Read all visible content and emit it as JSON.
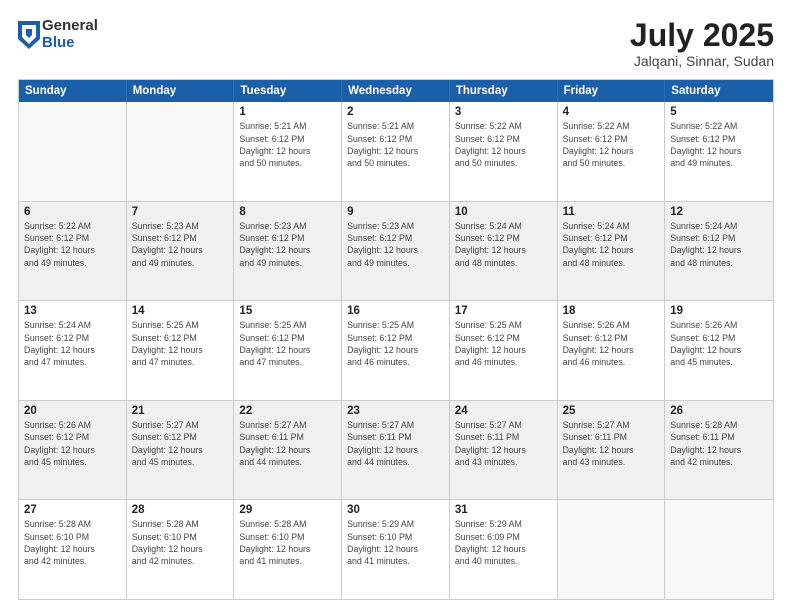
{
  "logo": {
    "general": "General",
    "blue": "Blue"
  },
  "title": {
    "month_year": "July 2025",
    "location": "Jalqani, Sinnar, Sudan"
  },
  "header_days": [
    "Sunday",
    "Monday",
    "Tuesday",
    "Wednesday",
    "Thursday",
    "Friday",
    "Saturday"
  ],
  "rows": [
    [
      {
        "day": "",
        "info": ""
      },
      {
        "day": "",
        "info": ""
      },
      {
        "day": "1",
        "info": "Sunrise: 5:21 AM\nSunset: 6:12 PM\nDaylight: 12 hours\nand 50 minutes."
      },
      {
        "day": "2",
        "info": "Sunrise: 5:21 AM\nSunset: 6:12 PM\nDaylight: 12 hours\nand 50 minutes."
      },
      {
        "day": "3",
        "info": "Sunrise: 5:22 AM\nSunset: 6:12 PM\nDaylight: 12 hours\nand 50 minutes."
      },
      {
        "day": "4",
        "info": "Sunrise: 5:22 AM\nSunset: 6:12 PM\nDaylight: 12 hours\nand 50 minutes."
      },
      {
        "day": "5",
        "info": "Sunrise: 5:22 AM\nSunset: 6:12 PM\nDaylight: 12 hours\nand 49 minutes."
      }
    ],
    [
      {
        "day": "6",
        "info": "Sunrise: 5:22 AM\nSunset: 6:12 PM\nDaylight: 12 hours\nand 49 minutes."
      },
      {
        "day": "7",
        "info": "Sunrise: 5:23 AM\nSunset: 6:12 PM\nDaylight: 12 hours\nand 49 minutes."
      },
      {
        "day": "8",
        "info": "Sunrise: 5:23 AM\nSunset: 6:12 PM\nDaylight: 12 hours\nand 49 minutes."
      },
      {
        "day": "9",
        "info": "Sunrise: 5:23 AM\nSunset: 6:12 PM\nDaylight: 12 hours\nand 49 minutes."
      },
      {
        "day": "10",
        "info": "Sunrise: 5:24 AM\nSunset: 6:12 PM\nDaylight: 12 hours\nand 48 minutes."
      },
      {
        "day": "11",
        "info": "Sunrise: 5:24 AM\nSunset: 6:12 PM\nDaylight: 12 hours\nand 48 minutes."
      },
      {
        "day": "12",
        "info": "Sunrise: 5:24 AM\nSunset: 6:12 PM\nDaylight: 12 hours\nand 48 minutes."
      }
    ],
    [
      {
        "day": "13",
        "info": "Sunrise: 5:24 AM\nSunset: 6:12 PM\nDaylight: 12 hours\nand 47 minutes."
      },
      {
        "day": "14",
        "info": "Sunrise: 5:25 AM\nSunset: 6:12 PM\nDaylight: 12 hours\nand 47 minutes."
      },
      {
        "day": "15",
        "info": "Sunrise: 5:25 AM\nSunset: 6:12 PM\nDaylight: 12 hours\nand 47 minutes."
      },
      {
        "day": "16",
        "info": "Sunrise: 5:25 AM\nSunset: 6:12 PM\nDaylight: 12 hours\nand 46 minutes."
      },
      {
        "day": "17",
        "info": "Sunrise: 5:25 AM\nSunset: 6:12 PM\nDaylight: 12 hours\nand 46 minutes."
      },
      {
        "day": "18",
        "info": "Sunrise: 5:26 AM\nSunset: 6:12 PM\nDaylight: 12 hours\nand 46 minutes."
      },
      {
        "day": "19",
        "info": "Sunrise: 5:26 AM\nSunset: 6:12 PM\nDaylight: 12 hours\nand 45 minutes."
      }
    ],
    [
      {
        "day": "20",
        "info": "Sunrise: 5:26 AM\nSunset: 6:12 PM\nDaylight: 12 hours\nand 45 minutes."
      },
      {
        "day": "21",
        "info": "Sunrise: 5:27 AM\nSunset: 6:12 PM\nDaylight: 12 hours\nand 45 minutes."
      },
      {
        "day": "22",
        "info": "Sunrise: 5:27 AM\nSunset: 6:11 PM\nDaylight: 12 hours\nand 44 minutes."
      },
      {
        "day": "23",
        "info": "Sunrise: 5:27 AM\nSunset: 6:11 PM\nDaylight: 12 hours\nand 44 minutes."
      },
      {
        "day": "24",
        "info": "Sunrise: 5:27 AM\nSunset: 6:11 PM\nDaylight: 12 hours\nand 43 minutes."
      },
      {
        "day": "25",
        "info": "Sunrise: 5:27 AM\nSunset: 6:11 PM\nDaylight: 12 hours\nand 43 minutes."
      },
      {
        "day": "26",
        "info": "Sunrise: 5:28 AM\nSunset: 6:11 PM\nDaylight: 12 hours\nand 42 minutes."
      }
    ],
    [
      {
        "day": "27",
        "info": "Sunrise: 5:28 AM\nSunset: 6:10 PM\nDaylight: 12 hours\nand 42 minutes."
      },
      {
        "day": "28",
        "info": "Sunrise: 5:28 AM\nSunset: 6:10 PM\nDaylight: 12 hours\nand 42 minutes."
      },
      {
        "day": "29",
        "info": "Sunrise: 5:28 AM\nSunset: 6:10 PM\nDaylight: 12 hours\nand 41 minutes."
      },
      {
        "day": "30",
        "info": "Sunrise: 5:29 AM\nSunset: 6:10 PM\nDaylight: 12 hours\nand 41 minutes."
      },
      {
        "day": "31",
        "info": "Sunrise: 5:29 AM\nSunset: 6:09 PM\nDaylight: 12 hours\nand 40 minutes."
      },
      {
        "day": "",
        "info": ""
      },
      {
        "day": "",
        "info": ""
      }
    ]
  ]
}
